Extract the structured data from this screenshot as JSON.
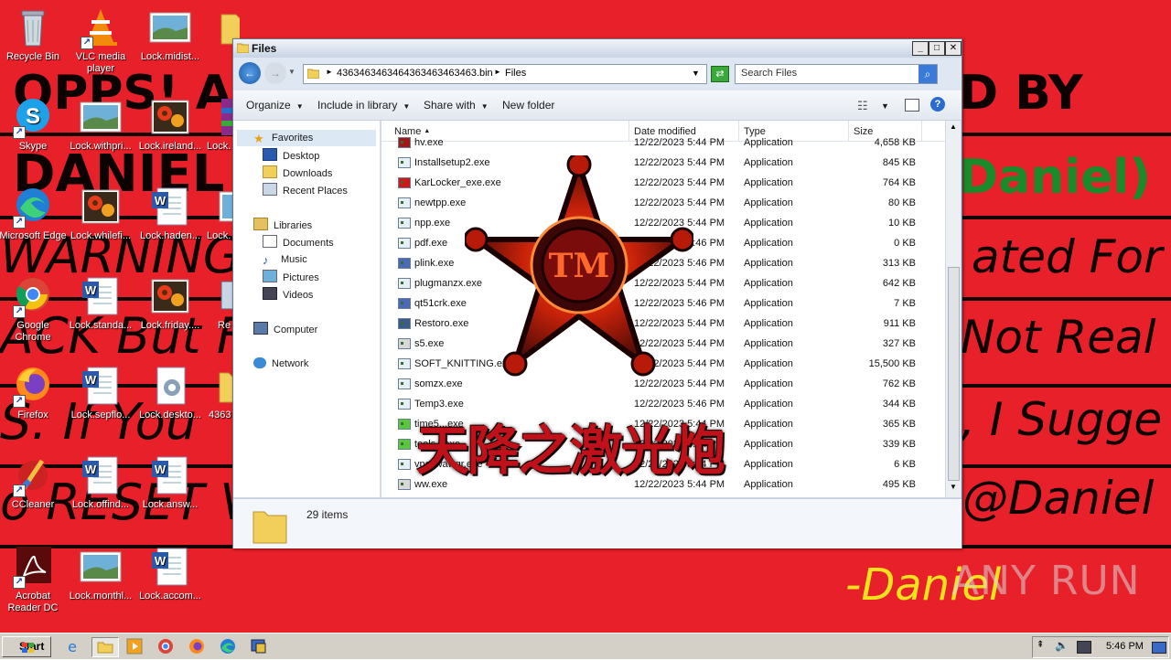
{
  "desktop": {
    "background_color": "#e8202a",
    "ransom_text": [
      "OPPS! AL",
      "D BY",
      "DANIEL",
      "Daniel)",
      "WARNING:",
      "ated For",
      "ACK But F",
      "Not Real",
      "S. If You",
      ", I Sugge",
      "o RESET V",
      "@Daniel",
      "-Daniel"
    ],
    "icons": [
      {
        "label": "Recycle Bin",
        "icon": "recycle-bin-icon"
      },
      {
        "label": "VLC media player",
        "icon": "vlc-icon"
      },
      {
        "label": "Lock.midist...",
        "icon": "image-icon"
      },
      {
        "label": "Skype",
        "icon": "skype-icon"
      },
      {
        "label": "Lock.withpri...",
        "icon": "image-icon"
      },
      {
        "label": "Lock.ireland...",
        "icon": "flower-image-icon"
      },
      {
        "label": "Lock.",
        "icon": "winrar-icon"
      },
      {
        "label": "Microsoft Edge",
        "icon": "edge-icon"
      },
      {
        "label": "Lock.whilefi...",
        "icon": "flower-image-icon"
      },
      {
        "label": "Lock.haden...",
        "icon": "word-doc-icon"
      },
      {
        "label": "Lock.",
        "icon": "image-icon"
      },
      {
        "label": "Google Chrome",
        "icon": "chrome-icon"
      },
      {
        "label": "Lock.standa...",
        "icon": "word-doc-icon"
      },
      {
        "label": "Lock.friday....",
        "icon": "flower-image-icon"
      },
      {
        "label": "Re",
        "icon": "generic-icon"
      },
      {
        "label": "Firefox",
        "icon": "firefox-icon"
      },
      {
        "label": "Lock.sepflo...",
        "icon": "word-doc-icon"
      },
      {
        "label": "Lock.deskto...",
        "icon": "settings-file-icon"
      },
      {
        "label": "4363",
        "icon": "folder-icon"
      },
      {
        "label": "CCleaner",
        "icon": "ccleaner-icon"
      },
      {
        "label": "Lock.offind...",
        "icon": "word-doc-icon"
      },
      {
        "label": "Lock.answ...",
        "icon": "word-doc-icon"
      },
      {
        "label": "Acrobat Reader DC",
        "icon": "acrobat-icon"
      },
      {
        "label": "Lock.monthl...",
        "icon": "image-icon"
      },
      {
        "label": "Lock.accom...",
        "icon": "word-doc-icon"
      }
    ]
  },
  "window": {
    "title": "Files",
    "address": {
      "path_segment": "4363463463464363463463463.bin",
      "separator": "►",
      "current": "Files"
    },
    "search_placeholder": "Search Files",
    "toolbar": {
      "organize": "Organize",
      "include_in_library": "Include in library",
      "share_with": "Share with",
      "new_folder": "New folder"
    },
    "nav": {
      "favorites": "Favorites",
      "desktop": "Desktop",
      "downloads": "Downloads",
      "recent_places": "Recent Places",
      "libraries": "Libraries",
      "documents": "Documents",
      "music": "Music",
      "pictures": "Pictures",
      "videos": "Videos",
      "computer": "Computer",
      "network": "Network"
    },
    "columns": {
      "name": "Name",
      "date_modified": "Date modified",
      "type": "Type",
      "size": "Size"
    },
    "files": [
      {
        "name": "hv.exe",
        "date": "12/22/2023 5:44 PM",
        "type": "Application",
        "size": "4,658 KB"
      },
      {
        "name": "Installsetup2.exe",
        "date": "12/22/2023 5:44 PM",
        "type": "Application",
        "size": "845 KB"
      },
      {
        "name": "KarLocker_exe.exe",
        "date": "12/22/2023 5:44 PM",
        "type": "Application",
        "size": "764 KB"
      },
      {
        "name": "newtpp.exe",
        "date": "12/22/2023 5:44 PM",
        "type": "Application",
        "size": "80 KB"
      },
      {
        "name": "npp.exe",
        "date": "12/22/2023 5:44 PM",
        "type": "Application",
        "size": "10 KB"
      },
      {
        "name": "pdf.exe",
        "date": "12/22/2023 5:46 PM",
        "type": "Application",
        "size": "0 KB"
      },
      {
        "name": "plink.exe",
        "date": "12/22/2023 5:46 PM",
        "type": "Application",
        "size": "313 KB"
      },
      {
        "name": "plugmanzx.exe",
        "date": "12/22/2023 5:44 PM",
        "type": "Application",
        "size": "642 KB"
      },
      {
        "name": "qt51crk.exe",
        "date": "12/22/2023 5:46 PM",
        "type": "Application",
        "size": "7 KB"
      },
      {
        "name": "Restoro.exe",
        "date": "12/22/2023 5:44 PM",
        "type": "Application",
        "size": "911 KB"
      },
      {
        "name": "s5.exe",
        "date": "12/22/2023 5:44 PM",
        "type": "Application",
        "size": "327 KB"
      },
      {
        "name": "SOFT_KNITTING.exe",
        "date": "12/22/2023 5:44 PM",
        "type": "Application",
        "size": "15,500 KB"
      },
      {
        "name": "somzx.exe",
        "date": "12/22/2023 5:44 PM",
        "type": "Application",
        "size": "762 KB"
      },
      {
        "name": "Temp3.exe",
        "date": "12/22/2023 5:46 PM",
        "type": "Application",
        "size": "344 KB"
      },
      {
        "name": "time5...exe",
        "date": "12/22/2023 5:44 PM",
        "type": "Application",
        "size": "365 KB"
      },
      {
        "name": "tools...exe",
        "date": "12/22/2023 5:44 PM",
        "type": "Application",
        "size": "339 KB"
      },
      {
        "name": "vpcswawqr.exe",
        "date": "12/22/2023 5:44 PM",
        "type": "Application",
        "size": "6 KB"
      },
      {
        "name": "ww.exe",
        "date": "12/22/2023 5:44 PM",
        "type": "Application",
        "size": "495 KB"
      }
    ],
    "status": {
      "item_count": "29 items"
    }
  },
  "overlay": {
    "chinese_text": "天降之激光炮",
    "emblem_letter": "TM"
  },
  "watermark": "ANY RUN",
  "taskbar": {
    "start": "Start",
    "clock": "5:46 PM"
  }
}
